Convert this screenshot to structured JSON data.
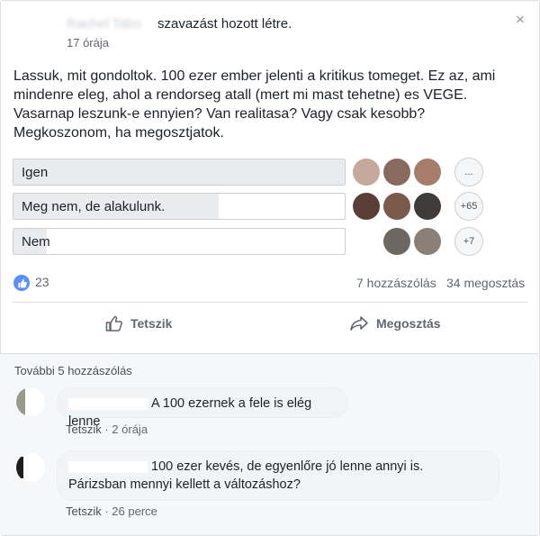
{
  "post": {
    "author": "Rachel Tabo",
    "poll_action": "szavazást hozott létre.",
    "time": "17 órája",
    "body_lines": [
      "Lassuk, mit gondoltok. 100 ezer ember jelenti a kritikus tomeget. Ez az, ami",
      "mindenre eleg, ahol a rendorseg atall (mert mi mast tehetne) es VEGE.",
      "Vasarnap leszunk-e ennyien? Van realitasa? Vagy csak kesobb?",
      "Megkoszonom, ha megosztjatok."
    ],
    "close_glyph": "×"
  },
  "poll": {
    "options": [
      {
        "label": "Igen",
        "fill": 1.0,
        "more": "...",
        "voter_colors": [
          "#c5a99b",
          "#8a6a5e",
          "#a67d6b"
        ]
      },
      {
        "label": "Meg nem, de alakulunk.",
        "fill": 0.62,
        "more": "+65",
        "voter_colors": [
          "#5a3f38",
          "#7b5a4c",
          "#3f3b38"
        ]
      },
      {
        "label": "Nem",
        "fill": 0.1,
        "more": "+7",
        "voter_colors": [
          "#ffffff",
          "#6e6660",
          "#8b8078"
        ]
      }
    ]
  },
  "stats": {
    "likes": "23",
    "comments": "7 hozzászólás",
    "shares": "34 megosztás"
  },
  "actions": {
    "like_label": "Tetszik",
    "share_label": "Megosztás"
  },
  "comments": {
    "more_label": "További 5 hozzászólás",
    "items": [
      {
        "text": "A 100 ezernek a fele is elég lenne",
        "like": "Tetszik",
        "time": "2 órája"
      },
      {
        "text_line1": "100 ezer kevés, de egyenlőre jó lenne annyi is.",
        "text_line2": "Párizsban mennyi kellett a változáshoz?",
        "like": "Tetszik",
        "time": "26 perce"
      }
    ]
  },
  "colors": {
    "accent": "#4267b2",
    "like_blue": "#5890ff",
    "muted": "#616770"
  }
}
